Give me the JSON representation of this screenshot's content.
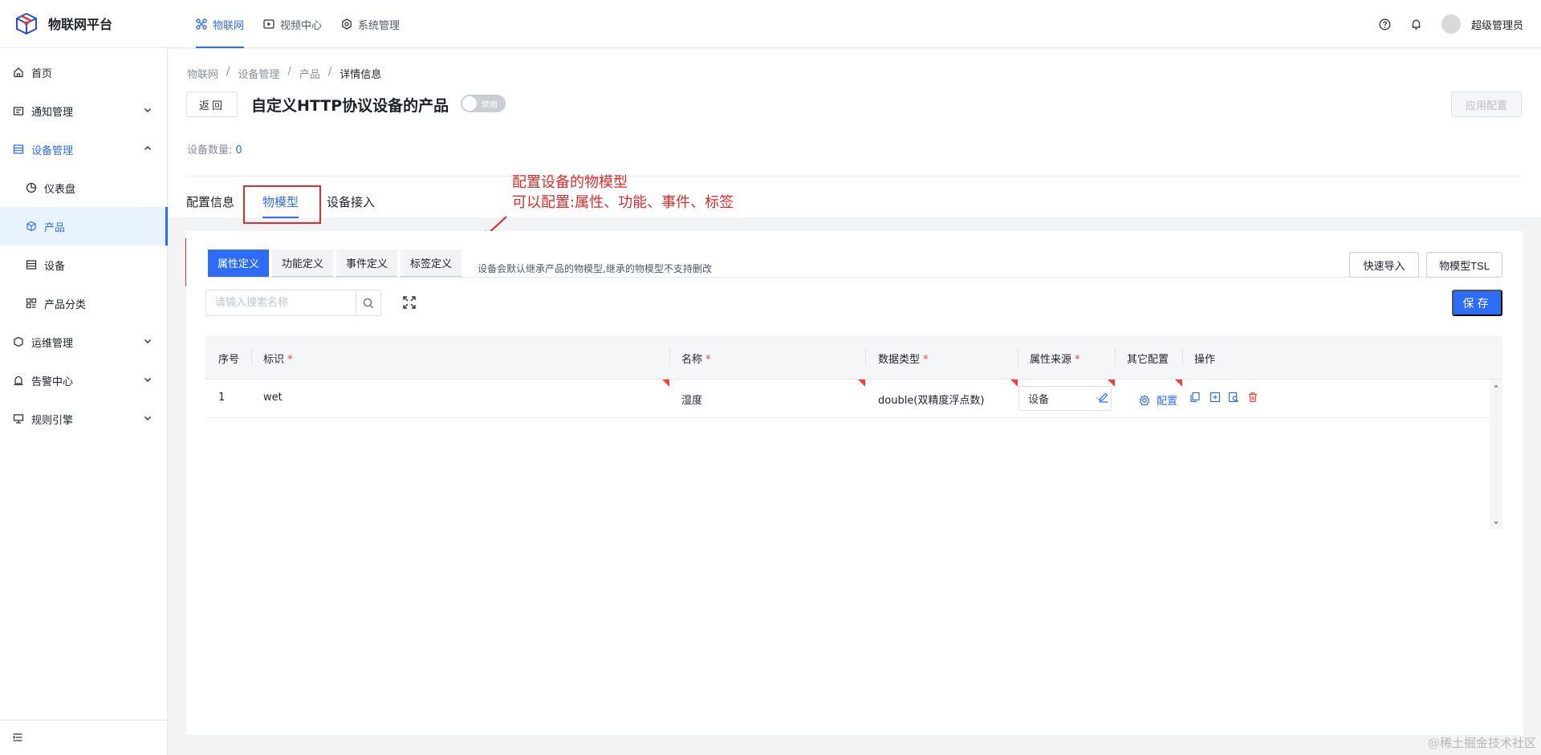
{
  "app": {
    "title": "物联网平台"
  },
  "topnav": [
    {
      "label": "物联网",
      "icon": "iot-icon",
      "active": true
    },
    {
      "label": "视频中心",
      "icon": "video-icon",
      "active": false
    },
    {
      "label": "系统管理",
      "icon": "settings-icon",
      "active": false
    }
  ],
  "user": {
    "name": "超级管理员"
  },
  "sidebar": {
    "items": [
      {
        "label": "首页",
        "icon": "home-icon"
      },
      {
        "label": "通知管理",
        "icon": "notice-icon"
      },
      {
        "label": "设备管理",
        "icon": "device-manage-icon"
      },
      {
        "label": "仪表盘",
        "icon": "dashboard-icon"
      },
      {
        "label": "产品",
        "icon": "product-icon"
      },
      {
        "label": "设备",
        "icon": "device-icon"
      },
      {
        "label": "产品分类",
        "icon": "category-icon"
      },
      {
        "label": "运维管理",
        "icon": "ops-icon"
      },
      {
        "label": "告警中心",
        "icon": "alarm-icon"
      },
      {
        "label": "规则引擎",
        "icon": "rule-icon"
      }
    ]
  },
  "breadcrumb": [
    "物联网",
    "设备管理",
    "产品",
    "详情信息"
  ],
  "header": {
    "back_label": "返回",
    "title": "自定义HTTP协议设备的产品",
    "toggle_label": "禁用",
    "apply_label": "应用配置",
    "device_count_label": "设备数量:",
    "device_count": "0"
  },
  "tabs": [
    "配置信息",
    "物模型",
    "设备接入"
  ],
  "annotation": {
    "line1": "配置设备的物模型",
    "line2": "可以配置:属性、功能、事件、标签"
  },
  "model": {
    "subtabs": [
      "属性定义",
      "功能定义",
      "事件定义",
      "标签定义"
    ],
    "hint": "设备会默认继承产品的物模型,继承的物模型不支持删改",
    "quick_import_label": "快速导入",
    "tsl_label": "物模型TSL",
    "search_placeholder": "请输入搜索名称",
    "save_label": "保存"
  },
  "table": {
    "columns": [
      "序号",
      "标识",
      "名称",
      "数据类型",
      "属性来源",
      "其它配置",
      "操作"
    ],
    "required": [
      "*",
      "*",
      "*",
      "*"
    ],
    "rows": [
      {
        "index": "1",
        "id": "wet",
        "name": "湿度",
        "type": "double(双精度浮点数)",
        "source": "设备",
        "config": "配置"
      }
    ]
  },
  "watermark": "@稀土掘金技术社区",
  "colors": {
    "accent": "#2d6cf6",
    "annotation": "#e02b2b",
    "required": "#f53f3f"
  }
}
